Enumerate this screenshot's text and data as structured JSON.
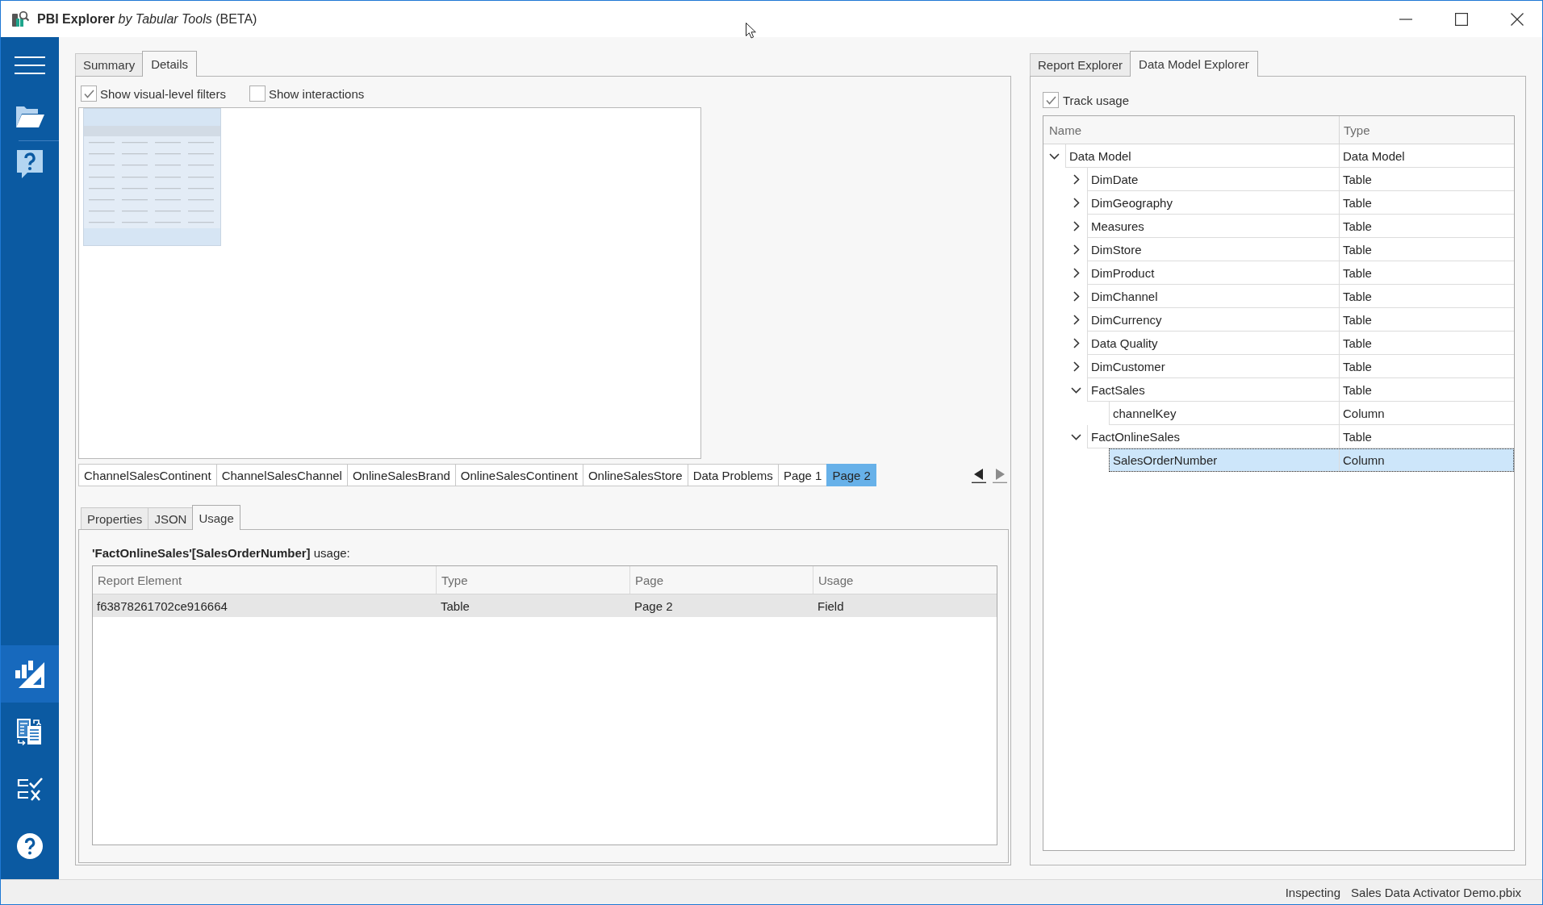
{
  "window": {
    "title": "**PBI Explorer** *by Tabular Tools* (BETA)"
  },
  "sidebar": {
    "top": [
      {
        "kind": "menu",
        "selected": false
      },
      {
        "kind": "open",
        "selected": false
      },
      {
        "kind": "feedback",
        "selected": false
      }
    ],
    "bottom": [
      {
        "kind": "report",
        "selected": true
      },
      {
        "kind": "compare",
        "selected": false
      },
      {
        "kind": "validate",
        "selected": false
      },
      {
        "kind": "help",
        "selected": false
      }
    ]
  },
  "details_panel": {
    "tabs": [
      {
        "label": "Summary",
        "selected": false
      },
      {
        "label": "Details",
        "selected": true
      }
    ],
    "options": [
      {
        "label": "Show visual-level filters",
        "checked": true
      },
      {
        "label": "Show interactions",
        "checked": false
      }
    ],
    "pages": [
      {
        "label": "ChannelSalesContinent",
        "selected": false
      },
      {
        "label": "ChannelSalesChannel",
        "selected": false
      },
      {
        "label": "OnlineSalesBrand",
        "selected": false
      },
      {
        "label": "OnlineSalesContinent",
        "selected": false
      },
      {
        "label": "OnlineSalesStore",
        "selected": false
      },
      {
        "label": "Data Problems",
        "selected": false
      },
      {
        "label": "Page 1",
        "selected": false
      },
      {
        "label": "Page 2",
        "selected": true
      }
    ],
    "page_nav": [
      {
        "kind": "previous",
        "disabled": false
      },
      {
        "kind": "next",
        "disabled": true
      }
    ]
  },
  "inspector": {
    "tabs": [
      {
        "label": "Properties",
        "selected": false
      },
      {
        "label": "JSON",
        "selected": false
      },
      {
        "label": "Usage",
        "selected": true
      }
    ],
    "heading": "**'FactOnlineSales'[SalesOrderNumber]** usage:",
    "columns": [
      "Report Element",
      "Type",
      "Page",
      "Usage"
    ],
    "rows": [
      {
        "cells": [
          "f63878261702ce916664",
          "Table",
          "Page 2",
          "Field"
        ],
        "selected": true
      }
    ]
  },
  "explorer": {
    "tabs": [
      {
        "label": "Report Explorer",
        "selected": false
      },
      {
        "label": "Data Model Explorer",
        "selected": true
      }
    ],
    "track_usage": {
      "label": "Track usage",
      "checked": true
    },
    "columns": [
      "Name",
      "Type"
    ],
    "nodes": [
      {
        "name": "Data Model",
        "type": "Data Model",
        "expanded": true,
        "selected": false,
        "children": [
          {
            "name": "DimDate",
            "type": "Table",
            "expanded": false,
            "selected": false
          },
          {
            "name": "DimGeography",
            "type": "Table",
            "expanded": false,
            "selected": false
          },
          {
            "name": "Measures",
            "type": "Table",
            "expanded": false,
            "selected": false
          },
          {
            "name": "DimStore",
            "type": "Table",
            "expanded": false,
            "selected": false
          },
          {
            "name": "DimProduct",
            "type": "Table",
            "expanded": false,
            "selected": false
          },
          {
            "name": "DimChannel",
            "type": "Table",
            "expanded": false,
            "selected": false
          },
          {
            "name": "DimCurrency",
            "type": "Table",
            "expanded": false,
            "selected": false
          },
          {
            "name": "Data Quality",
            "type": "Table",
            "expanded": false,
            "selected": false
          },
          {
            "name": "DimCustomer",
            "type": "Table",
            "expanded": false,
            "selected": false
          },
          {
            "name": "FactSales",
            "type": "Table",
            "expanded": true,
            "selected": false,
            "children": [
              {
                "name": "channelKey",
                "type": "Column",
                "selected": false
              }
            ]
          },
          {
            "name": "FactOnlineSales",
            "type": "Table",
            "expanded": true,
            "selected": false,
            "children": [
              {
                "name": "SalesOrderNumber",
                "type": "Column",
                "selected": true
              }
            ]
          }
        ]
      }
    ]
  },
  "status_bar": [
    "Inspecting",
    "Sales Data Activator Demo.pbix"
  ]
}
